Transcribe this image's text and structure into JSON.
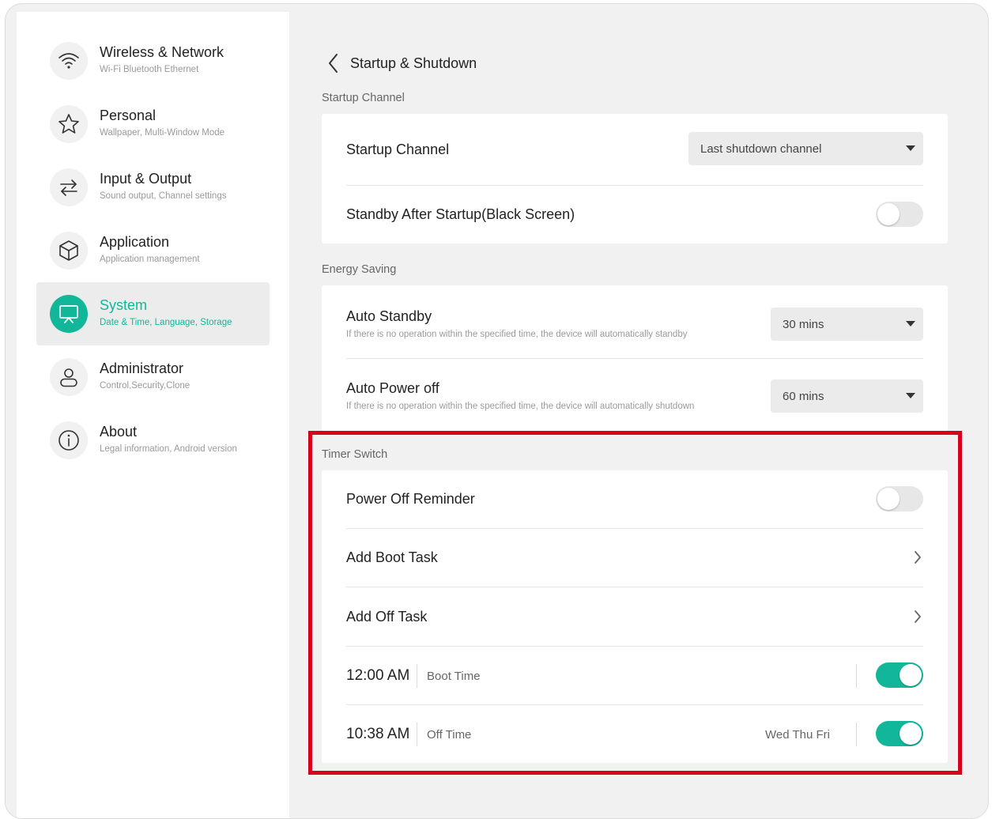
{
  "colors": {
    "accent": "#12b79a",
    "highlight": "#d6001c"
  },
  "sidebar": {
    "items": [
      {
        "icon": "wifi-icon",
        "title": "Wireless & Network",
        "subtitle": "Wi-Fi Bluetooth Ethernet",
        "active": false
      },
      {
        "icon": "star-icon",
        "title": "Personal",
        "subtitle": "Wallpaper, Multi-Window Mode",
        "active": false
      },
      {
        "icon": "swap-arrows-icon",
        "title": "Input & Output",
        "subtitle": "Sound output, Channel settings",
        "active": false
      },
      {
        "icon": "cube-icon",
        "title": "Application",
        "subtitle": "Application management",
        "active": false
      },
      {
        "icon": "monitor-icon",
        "title": "System",
        "subtitle": "Date & Time, Language, Storage",
        "active": true
      },
      {
        "icon": "user-icon",
        "title": "Administrator",
        "subtitle": "Control,Security,Clone",
        "active": false
      },
      {
        "icon": "info-icon",
        "title": "About",
        "subtitle": "Legal information, Android version",
        "active": false
      }
    ]
  },
  "header": {
    "title": "Startup & Shutdown",
    "back_icon": "chevron-left-icon"
  },
  "startup": {
    "section_label": "Startup Channel",
    "channel_title": "Startup Channel",
    "channel_value": "Last shutdown channel",
    "standby_title": "Standby After Startup(Black Screen)",
    "standby_on": false
  },
  "energy": {
    "section_label": "Energy Saving",
    "auto_standby_title": "Auto Standby",
    "auto_standby_desc": "If there is no operation within the specified time, the device will automatically standby",
    "auto_standby_value": "30 mins",
    "auto_power_off_title": "Auto Power off",
    "auto_power_off_desc": "If there is no operation within the specified time, the device will automatically shutdown",
    "auto_power_off_value": "60 mins"
  },
  "timer": {
    "section_label": "Timer Switch",
    "reminder_title": "Power Off Reminder",
    "reminder_on": false,
    "add_boot_title": "Add Boot Task",
    "add_off_title": "Add Off Task",
    "tasks": [
      {
        "time": "12:00 AM",
        "label": "Boot Time",
        "days": "",
        "enabled": true
      },
      {
        "time": "10:38 AM",
        "label": "Off Time",
        "days": "Wed Thu Fri",
        "enabled": true
      }
    ]
  }
}
